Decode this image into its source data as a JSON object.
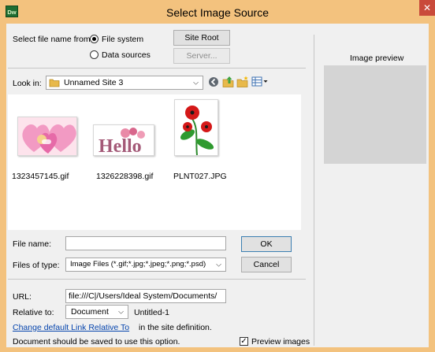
{
  "window": {
    "app_icon": "Dw",
    "title": "Select Image Source",
    "close_glyph": "✕"
  },
  "source": {
    "label": "Select file name from:",
    "options": [
      {
        "label": "File system",
        "checked": true
      },
      {
        "label": "Data sources",
        "checked": false
      }
    ],
    "site_root_button": "Site Root",
    "server_button": "Server..."
  },
  "look_in": {
    "label": "Look in:",
    "value": "Unnamed Site 3",
    "toolbar_icons": [
      "go-back-icon",
      "up-folder-icon",
      "new-folder-icon",
      "view-menu-icon"
    ]
  },
  "files": [
    {
      "name": "1323457145.gif",
      "icon": "hearts-image-thumbnail"
    },
    {
      "name": "1326228398.gif",
      "icon": "hello-image-thumbnail"
    },
    {
      "name": "PLNT027.JPG",
      "icon": "flower-image-thumbnail"
    }
  ],
  "preview": {
    "label": "Image preview"
  },
  "form": {
    "file_name_label": "File name:",
    "file_name_value": "",
    "files_of_type_label": "Files of type:",
    "files_of_type_value": "Image Files (*.gif;*.jpg;*.jpeg;*.png;*.psd)",
    "ok_button": "OK",
    "cancel_button": "Cancel",
    "url_label": "URL:",
    "url_value": "file:///C|/Users/Ideal System/Documents/",
    "relative_to_label": "Relative to:",
    "relative_to_value": "Document",
    "relative_doc_name": "Untitled-1",
    "link_text": "Change default Link Relative To",
    "link_suffix": "in the site definition.",
    "note": "Document should be saved to use this option.",
    "preview_images_label": "Preview images",
    "preview_images_checked": true
  },
  "colors": {
    "title_bar": "#f3c27e",
    "close_button": "#c94a3a",
    "link": "#0645ad",
    "preview_box": "#d4d4d4"
  }
}
